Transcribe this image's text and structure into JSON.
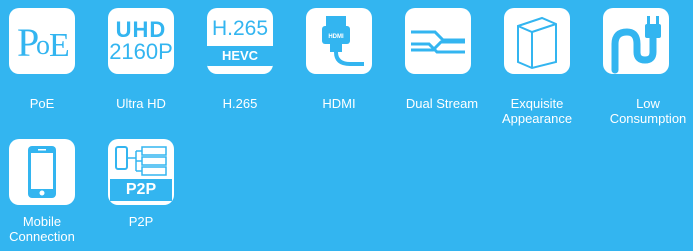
{
  "features": [
    {
      "id": "poe",
      "icon": "poe-icon",
      "label": "PoE",
      "icon_text": "PoE"
    },
    {
      "id": "uhd",
      "icon": "uhd-icon",
      "label": "Ultra HD",
      "icon_text_top": "UHD",
      "icon_text_bottom": "2160P"
    },
    {
      "id": "h265",
      "icon": "h265-icon",
      "label": "H.265",
      "icon_text_top": "H.265",
      "icon_text_bottom": "HEVC"
    },
    {
      "id": "hdmi",
      "icon": "hdmi-plug-icon",
      "label": "HDMI",
      "icon_text": "HDMI"
    },
    {
      "id": "dual-stream",
      "icon": "dual-stream-icon",
      "label": "Dual Stream"
    },
    {
      "id": "appearance",
      "icon": "box-icon",
      "label_line1": "Exquisite",
      "label_line2": "Appearance"
    },
    {
      "id": "low-power",
      "icon": "power-plug-icon",
      "label_line1": "Low",
      "label_line2": "Consumption"
    },
    {
      "id": "mobile",
      "icon": "smartphone-icon",
      "label_line1": "Mobile",
      "label_line2": "Connection"
    },
    {
      "id": "p2p",
      "icon": "p2p-network-icon",
      "label": "P2P",
      "icon_text": "P2P"
    }
  ],
  "colors": {
    "background": "#33b5f0",
    "tile": "#ffffff",
    "accent": "#33b5f0"
  }
}
